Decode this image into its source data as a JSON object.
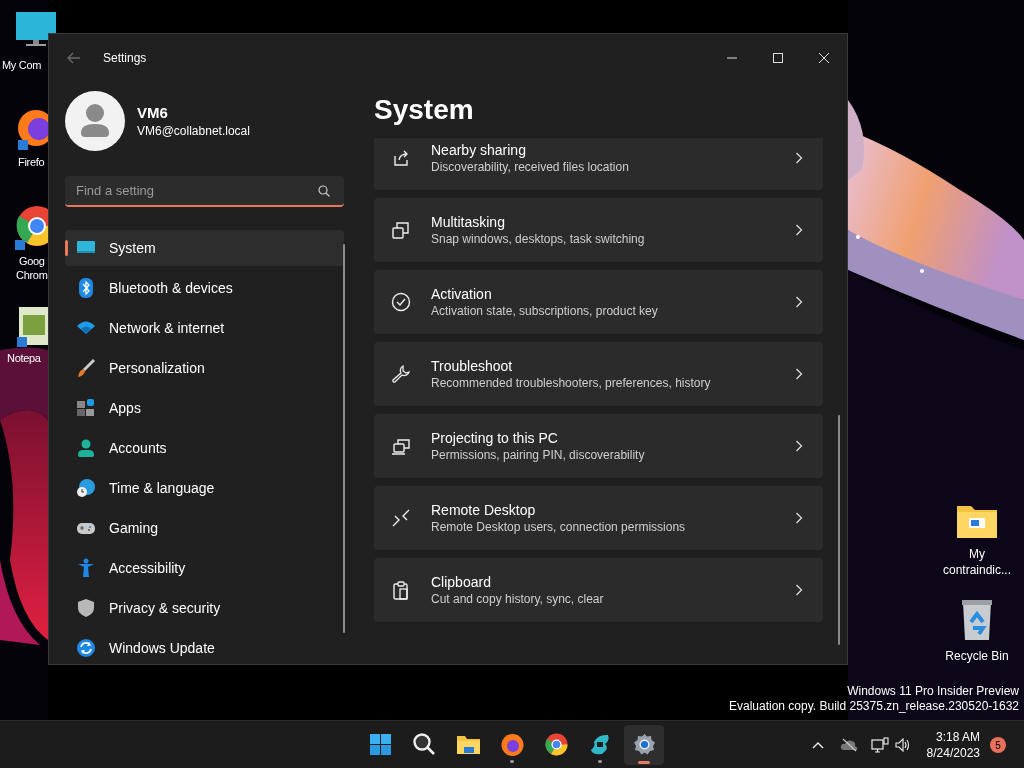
{
  "desktop_left": [
    {
      "lines": [
        "My Com"
      ]
    },
    {
      "lines": [
        "Firefo"
      ]
    },
    {
      "lines": [
        "Goog",
        "Chrom"
      ]
    },
    {
      "lines": [
        "Notepa"
      ]
    }
  ],
  "desktop_right": [
    {
      "lines": [
        "My",
        "contraindic..."
      ]
    },
    {
      "lines": [
        "Recycle Bin"
      ]
    }
  ],
  "window": {
    "title": "Settings"
  },
  "account": {
    "name": "VM6",
    "email": "VM6@collabnet.local"
  },
  "search": {
    "placeholder": "Find a setting"
  },
  "nav": [
    {
      "label": "System",
      "selected": true
    },
    {
      "label": "Bluetooth & devices",
      "selected": false
    },
    {
      "label": "Network & internet",
      "selected": false
    },
    {
      "label": "Personalization",
      "selected": false
    },
    {
      "label": "Apps",
      "selected": false
    },
    {
      "label": "Accounts",
      "selected": false
    },
    {
      "label": "Time & language",
      "selected": false
    },
    {
      "label": "Gaming",
      "selected": false
    },
    {
      "label": "Accessibility",
      "selected": false
    },
    {
      "label": "Privacy & security",
      "selected": false
    },
    {
      "label": "Windows Update",
      "selected": false
    }
  ],
  "heading": "System",
  "cards": [
    {
      "title": "Nearby sharing",
      "subtitle": "Discoverability, received files location"
    },
    {
      "title": "Multitasking",
      "subtitle": "Snap windows, desktops, task switching"
    },
    {
      "title": "Activation",
      "subtitle": "Activation state, subscriptions, product key"
    },
    {
      "title": "Troubleshoot",
      "subtitle": "Recommended troubleshooters, preferences, history"
    },
    {
      "title": "Projecting to this PC",
      "subtitle": "Permissions, pairing PIN, discoverability"
    },
    {
      "title": "Remote Desktop",
      "subtitle": "Remote Desktop users, connection permissions"
    },
    {
      "title": "Clipboard",
      "subtitle": "Cut and copy history, sync, clear"
    }
  ],
  "desktop_notice": [
    "Windows 11 Pro Insider Preview",
    "Evaluation copy. Build 25375.zn_release.230520-1632"
  ],
  "taskbar": {
    "apps": [
      {
        "running": false,
        "selected": false
      },
      {
        "running": false,
        "selected": false
      },
      {
        "running": false,
        "selected": false
      },
      {
        "running": true,
        "selected": false
      },
      {
        "running": false,
        "selected": false
      },
      {
        "running": true,
        "selected": false
      },
      {
        "running": true,
        "selected": true
      }
    ],
    "time": "3:18 AM",
    "date": "8/24/2023",
    "badge": "5"
  }
}
